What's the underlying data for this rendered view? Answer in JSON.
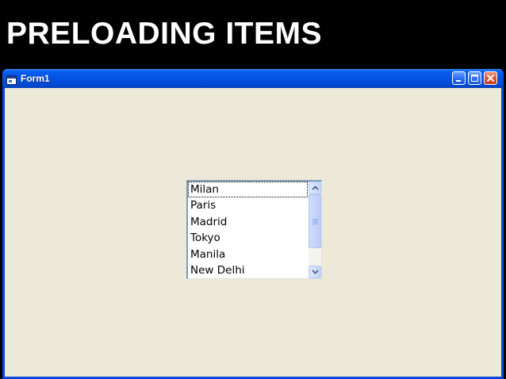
{
  "slide": {
    "title": "PRELOADING ITEMS"
  },
  "window": {
    "title": "Form1",
    "controls": {
      "minimize": "minimize",
      "maximize": "maximize",
      "close": "close"
    }
  },
  "listbox": {
    "items": [
      "Milan",
      "Paris",
      "Madrid",
      "Tokyo",
      "Manila",
      "New Delhi"
    ],
    "selected_index": 0
  },
  "icons": {
    "app": "form-icon",
    "scroll_up": "chevron-up-icon",
    "scroll_down": "chevron-down-icon"
  },
  "colors": {
    "titlebar": "#0453e0",
    "client_background": "#ece9d8",
    "close_button": "#e0502e",
    "slide_background": "#000000"
  }
}
